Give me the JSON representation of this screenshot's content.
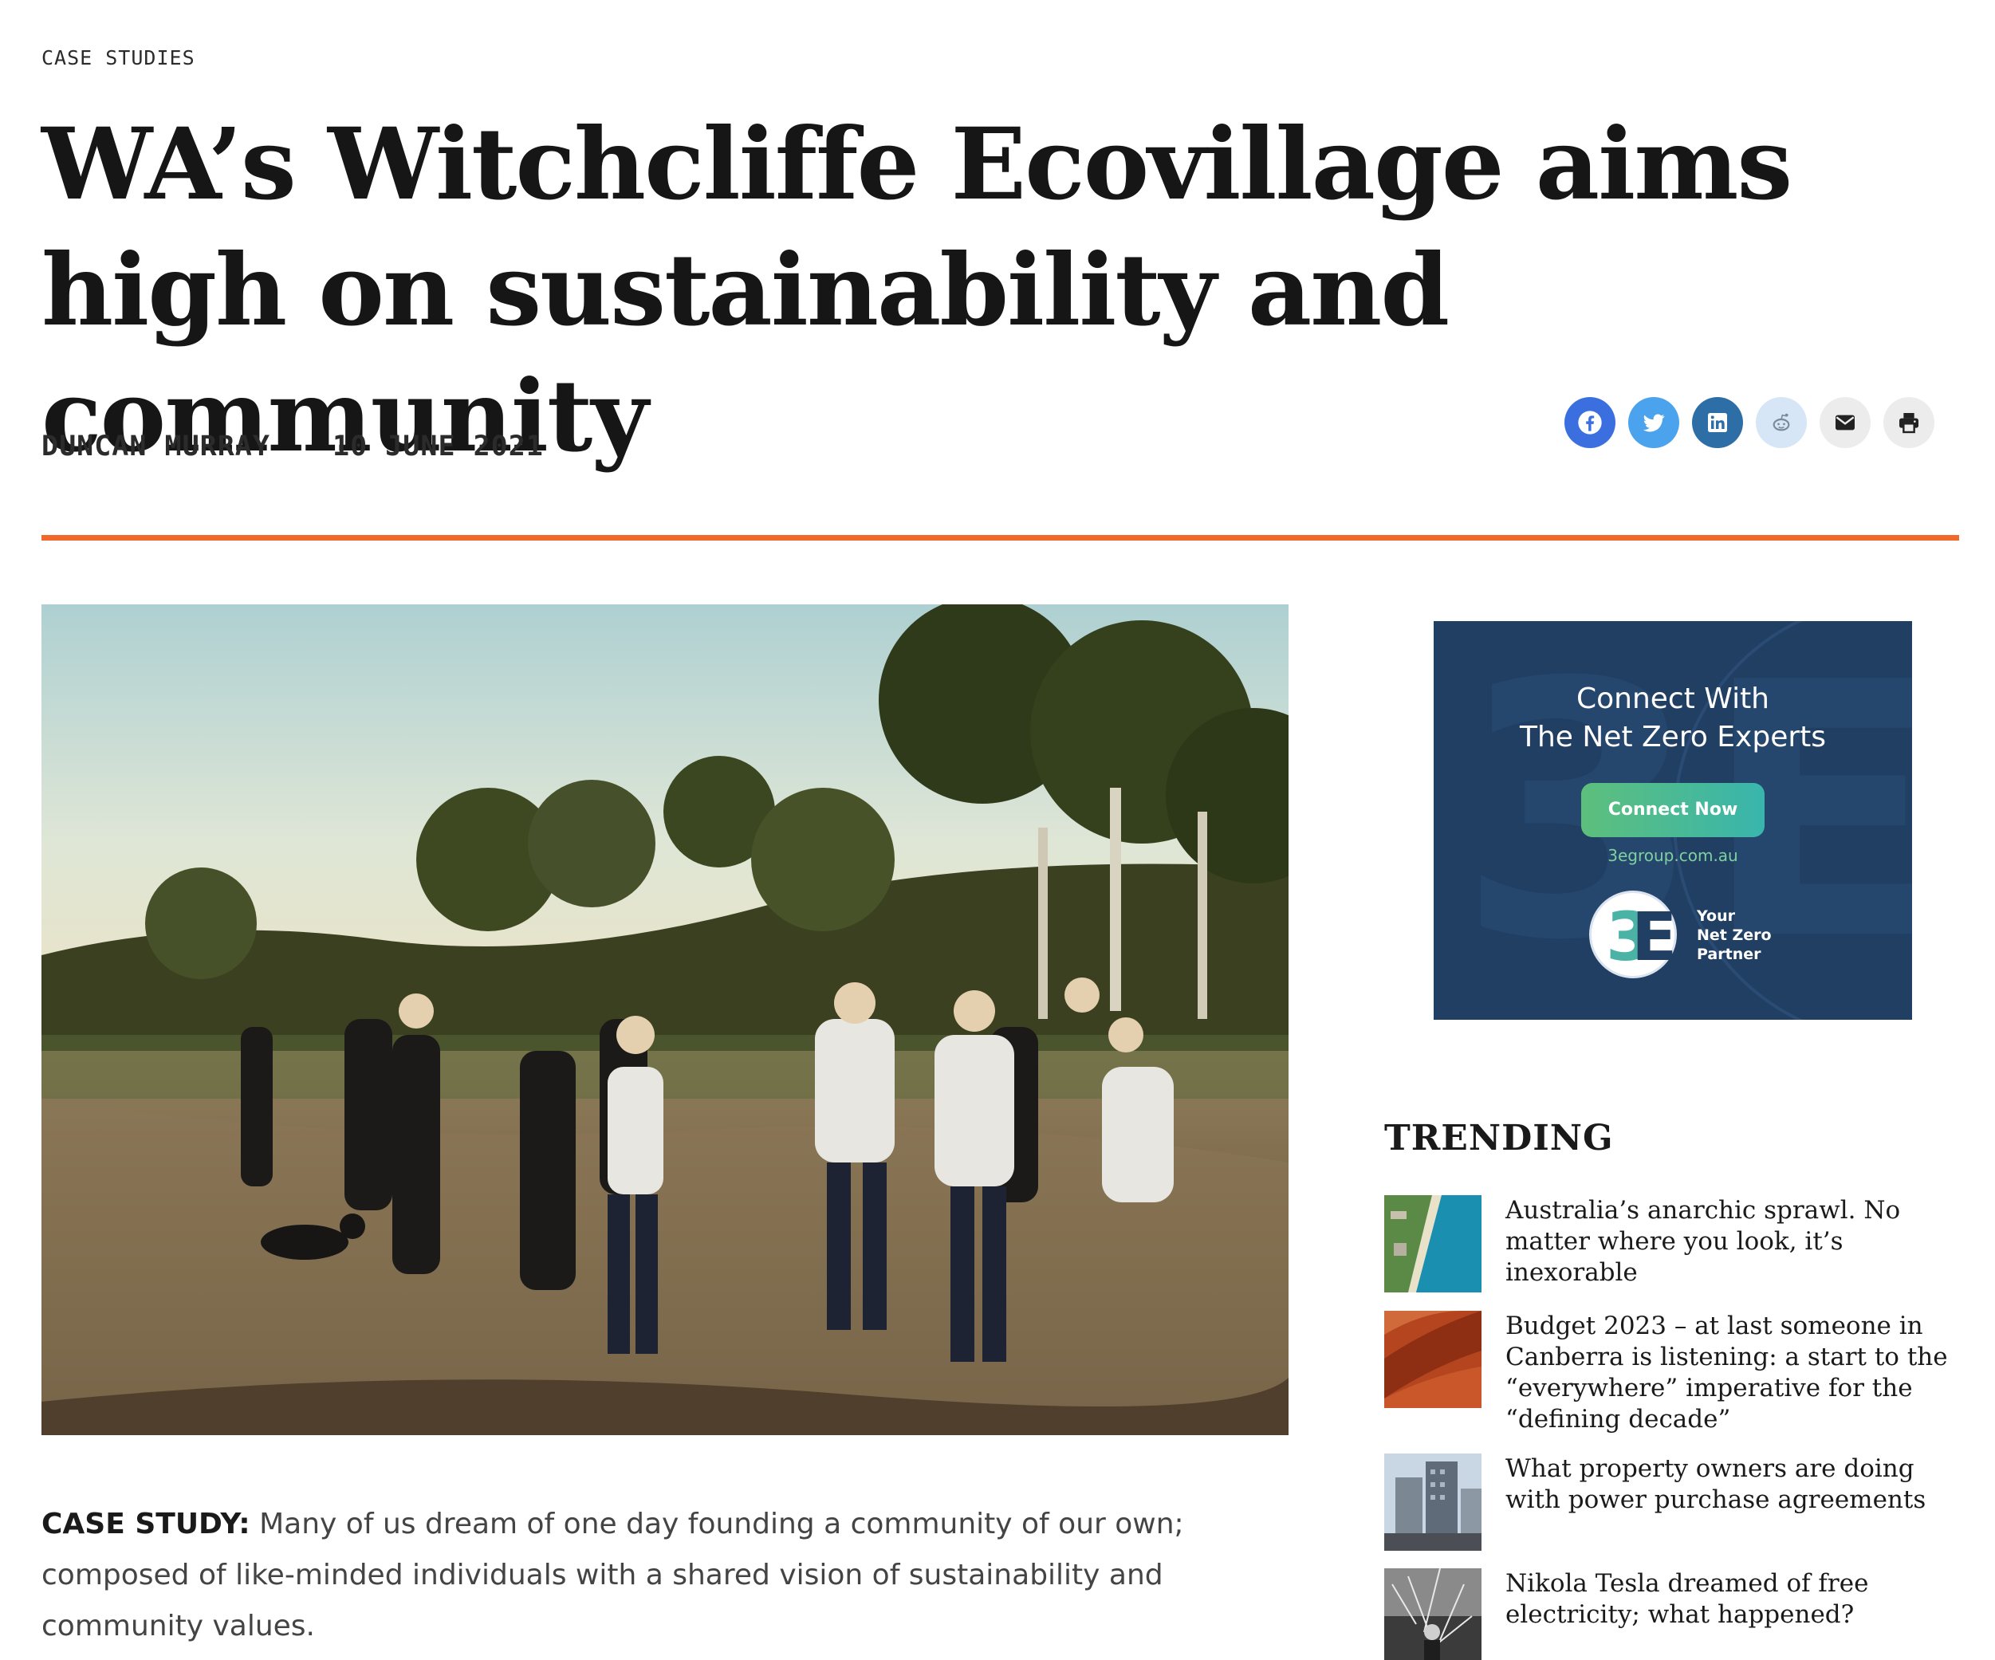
{
  "article": {
    "category": "CASE STUDIES",
    "title": "WA’s Witchcliffe Ecovillage aims high on sustainability and community",
    "author": "DUNCAN MURRAY",
    "date": "10 JUNE 2021",
    "lead_label": "CASE STUDY:",
    "lead_text": "Many of us dream of one day founding a community of our own; composed of like-minded individuals with a shared vision of sustainability and community values."
  },
  "share": [
    {
      "name": "facebook",
      "icon": "facebook-icon",
      "bg": "#3b6fe0"
    },
    {
      "name": "twitter",
      "icon": "twitter-icon",
      "bg": "#4aa3ec"
    },
    {
      "name": "linkedin",
      "icon": "linkedin-icon",
      "bg": "#2e6ea6"
    },
    {
      "name": "reddit",
      "icon": "reddit-icon",
      "bg": "#d6e6f6"
    },
    {
      "name": "email",
      "icon": "email-icon",
      "bg": "#ececec"
    },
    {
      "name": "print",
      "icon": "print-icon",
      "bg": "#ececec"
    }
  ],
  "colors": {
    "accent_rule": "#f0692a",
    "ad_background": "#213f63"
  },
  "ad": {
    "headline_line1": "Connect With",
    "headline_line2": "The Net Zero Experts",
    "button": "Connect Now",
    "url": "3egroup.com.au",
    "tagline_line1": "Your",
    "tagline_line2": "Net Zero",
    "tagline_line3": "Partner"
  },
  "trending": {
    "heading": "TRENDING",
    "items": [
      {
        "title": "Australia’s anarchic sprawl. No matter where you look, it’s inexorable",
        "thumb": "coastline-photo"
      },
      {
        "title": "Budget 2023 – at last someone in Canberra is listening: a start to the “everywhere” imperative for the “defining decade”",
        "thumb": "red-rock-photo"
      },
      {
        "title": "What property owners are doing with power purchase agreements",
        "thumb": "city-buildings-photo"
      },
      {
        "title": "Nikola Tesla dreamed of free electricity; what happened?",
        "thumb": "tesla-lab-photo"
      }
    ]
  }
}
